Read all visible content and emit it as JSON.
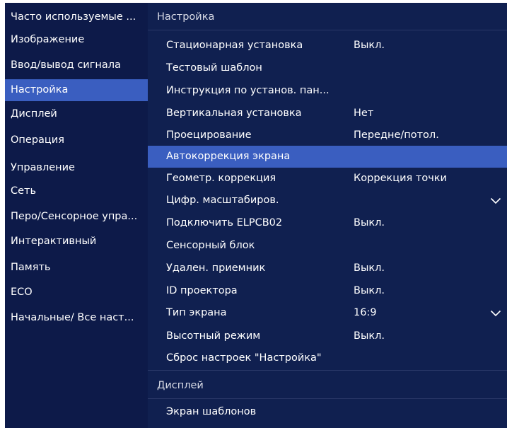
{
  "sidebar": {
    "items": [
      {
        "label": "Часто используемые ...",
        "selected": false
      },
      {
        "label": "Изображение",
        "selected": false
      },
      {
        "label": "Ввод/вывод сигнала",
        "selected": false
      },
      {
        "label": "Настройка",
        "selected": true
      },
      {
        "label": "Дисплей",
        "selected": false
      },
      {
        "label": "Операция",
        "selected": false
      },
      {
        "label": "Управление",
        "selected": false
      },
      {
        "label": "Сеть",
        "selected": false
      },
      {
        "label": "Перо/Сенсорное упра...",
        "selected": false
      },
      {
        "label": "Интерактивный",
        "selected": false
      },
      {
        "label": "Память",
        "selected": false
      },
      {
        "label": "ECO",
        "selected": false
      },
      {
        "label": "Начальные/ Все наст...",
        "selected": false
      }
    ]
  },
  "main": {
    "sections": [
      {
        "title": "Настройка",
        "rows": [
          {
            "label": "Стационарная установка",
            "value": "Выкл."
          },
          {
            "label": "Тестовый шаблон",
            "value": ""
          },
          {
            "label": "Инструкция по установ. пан...",
            "value": ""
          },
          {
            "label": "Вертикальная установка",
            "value": "Нет"
          },
          {
            "label": "Проецирование",
            "value": "Передне/потол."
          },
          {
            "label": "Автокоррекция экрана",
            "value": "",
            "highlighted": true
          },
          {
            "label": "Геометр. коррекция",
            "value": "Коррекция точки"
          },
          {
            "label": "Цифр. масштабиров.",
            "value": "",
            "expandable": true
          },
          {
            "label": "Подключить ELPCB02",
            "value": "Выкл."
          },
          {
            "label": "Сенсорный блок",
            "value": ""
          },
          {
            "label": "Удален. приемник",
            "value": "Выкл."
          },
          {
            "label": "ID проектора",
            "value": "Выкл."
          },
          {
            "label": "Тип экрана",
            "value": "16:9",
            "expandable": true
          },
          {
            "label": "Высотный режим",
            "value": "Выкл."
          },
          {
            "label": "Сброс настроек \"Настройка\"",
            "value": ""
          }
        ]
      },
      {
        "title": "Дисплей",
        "rows": [
          {
            "label": "Экран шаблонов",
            "value": ""
          }
        ]
      }
    ]
  },
  "icons": {
    "expand": "chevron-down-icon"
  },
  "colors": {
    "background": "#0d1a49",
    "panel": "#102050",
    "selected": "#3a5ec0",
    "text": "#ffffff"
  }
}
